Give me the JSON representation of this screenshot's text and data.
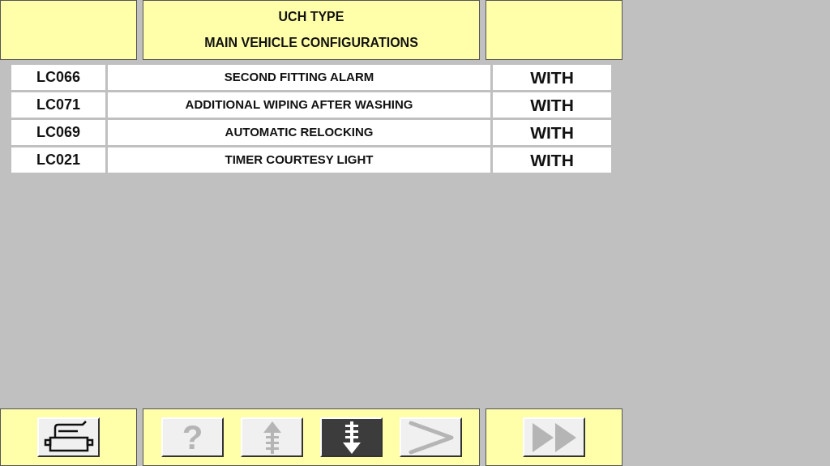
{
  "header": {
    "title": "UCH TYPE",
    "subtitle": "MAIN VEHICLE CONFIGURATIONS"
  },
  "rows": [
    {
      "code": "LC066",
      "label": "SECOND FITTING ALARM",
      "value": "WITH"
    },
    {
      "code": "LC071",
      "label": "ADDITIONAL WIPING AFTER WASHING",
      "value": "WITH"
    },
    {
      "code": "LC069",
      "label": "AUTOMATIC RELOCKING",
      "value": "WITH"
    },
    {
      "code": "LC021",
      "label": "TIMER COURTESY LIGHT",
      "value": "WITH"
    }
  ],
  "toolbar": {
    "left": [
      {
        "kind": "print",
        "disabled": false,
        "selected": false
      }
    ],
    "center": [
      {
        "kind": "help",
        "text": "?",
        "disabled": true,
        "selected": false
      },
      {
        "kind": "up",
        "disabled": true,
        "selected": false
      },
      {
        "kind": "down",
        "disabled": false,
        "selected": true
      },
      {
        "kind": "next",
        "disabled": true,
        "selected": false
      }
    ],
    "right": [
      {
        "kind": "fast-forward",
        "disabled": true,
        "selected": false
      }
    ]
  }
}
